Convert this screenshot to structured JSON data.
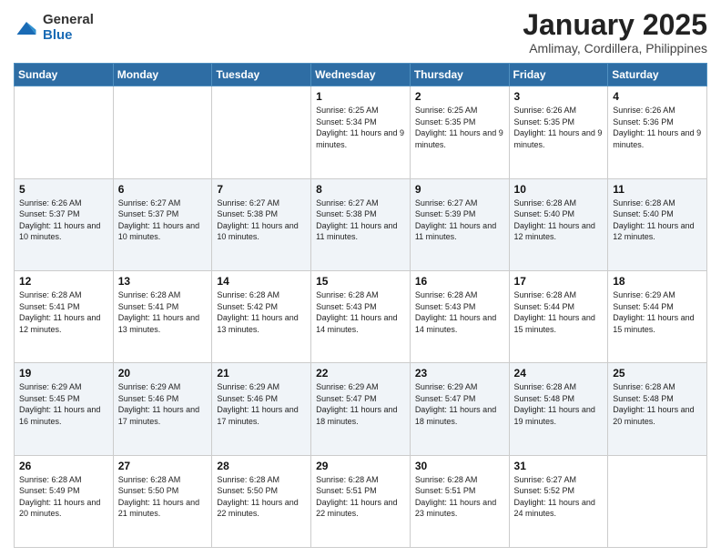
{
  "header": {
    "logo": {
      "general": "General",
      "blue": "Blue"
    },
    "title": "January 2025",
    "subtitle": "Amlimay, Cordillera, Philippines"
  },
  "weekdays": [
    "Sunday",
    "Monday",
    "Tuesday",
    "Wednesday",
    "Thursday",
    "Friday",
    "Saturday"
  ],
  "weeks": [
    [
      {
        "day": "",
        "sunrise": "",
        "sunset": "",
        "daylight": ""
      },
      {
        "day": "",
        "sunrise": "",
        "sunset": "",
        "daylight": ""
      },
      {
        "day": "",
        "sunrise": "",
        "sunset": "",
        "daylight": ""
      },
      {
        "day": "1",
        "sunrise": "Sunrise: 6:25 AM",
        "sunset": "Sunset: 5:34 PM",
        "daylight": "Daylight: 11 hours and 9 minutes."
      },
      {
        "day": "2",
        "sunrise": "Sunrise: 6:25 AM",
        "sunset": "Sunset: 5:35 PM",
        "daylight": "Daylight: 11 hours and 9 minutes."
      },
      {
        "day": "3",
        "sunrise": "Sunrise: 6:26 AM",
        "sunset": "Sunset: 5:35 PM",
        "daylight": "Daylight: 11 hours and 9 minutes."
      },
      {
        "day": "4",
        "sunrise": "Sunrise: 6:26 AM",
        "sunset": "Sunset: 5:36 PM",
        "daylight": "Daylight: 11 hours and 9 minutes."
      }
    ],
    [
      {
        "day": "5",
        "sunrise": "Sunrise: 6:26 AM",
        "sunset": "Sunset: 5:37 PM",
        "daylight": "Daylight: 11 hours and 10 minutes."
      },
      {
        "day": "6",
        "sunrise": "Sunrise: 6:27 AM",
        "sunset": "Sunset: 5:37 PM",
        "daylight": "Daylight: 11 hours and 10 minutes."
      },
      {
        "day": "7",
        "sunrise": "Sunrise: 6:27 AM",
        "sunset": "Sunset: 5:38 PM",
        "daylight": "Daylight: 11 hours and 10 minutes."
      },
      {
        "day": "8",
        "sunrise": "Sunrise: 6:27 AM",
        "sunset": "Sunset: 5:38 PM",
        "daylight": "Daylight: 11 hours and 11 minutes."
      },
      {
        "day": "9",
        "sunrise": "Sunrise: 6:27 AM",
        "sunset": "Sunset: 5:39 PM",
        "daylight": "Daylight: 11 hours and 11 minutes."
      },
      {
        "day": "10",
        "sunrise": "Sunrise: 6:28 AM",
        "sunset": "Sunset: 5:40 PM",
        "daylight": "Daylight: 11 hours and 12 minutes."
      },
      {
        "day": "11",
        "sunrise": "Sunrise: 6:28 AM",
        "sunset": "Sunset: 5:40 PM",
        "daylight": "Daylight: 11 hours and 12 minutes."
      }
    ],
    [
      {
        "day": "12",
        "sunrise": "Sunrise: 6:28 AM",
        "sunset": "Sunset: 5:41 PM",
        "daylight": "Daylight: 11 hours and 12 minutes."
      },
      {
        "day": "13",
        "sunrise": "Sunrise: 6:28 AM",
        "sunset": "Sunset: 5:41 PM",
        "daylight": "Daylight: 11 hours and 13 minutes."
      },
      {
        "day": "14",
        "sunrise": "Sunrise: 6:28 AM",
        "sunset": "Sunset: 5:42 PM",
        "daylight": "Daylight: 11 hours and 13 minutes."
      },
      {
        "day": "15",
        "sunrise": "Sunrise: 6:28 AM",
        "sunset": "Sunset: 5:43 PM",
        "daylight": "Daylight: 11 hours and 14 minutes."
      },
      {
        "day": "16",
        "sunrise": "Sunrise: 6:28 AM",
        "sunset": "Sunset: 5:43 PM",
        "daylight": "Daylight: 11 hours and 14 minutes."
      },
      {
        "day": "17",
        "sunrise": "Sunrise: 6:28 AM",
        "sunset": "Sunset: 5:44 PM",
        "daylight": "Daylight: 11 hours and 15 minutes."
      },
      {
        "day": "18",
        "sunrise": "Sunrise: 6:29 AM",
        "sunset": "Sunset: 5:44 PM",
        "daylight": "Daylight: 11 hours and 15 minutes."
      }
    ],
    [
      {
        "day": "19",
        "sunrise": "Sunrise: 6:29 AM",
        "sunset": "Sunset: 5:45 PM",
        "daylight": "Daylight: 11 hours and 16 minutes."
      },
      {
        "day": "20",
        "sunrise": "Sunrise: 6:29 AM",
        "sunset": "Sunset: 5:46 PM",
        "daylight": "Daylight: 11 hours and 17 minutes."
      },
      {
        "day": "21",
        "sunrise": "Sunrise: 6:29 AM",
        "sunset": "Sunset: 5:46 PM",
        "daylight": "Daylight: 11 hours and 17 minutes."
      },
      {
        "day": "22",
        "sunrise": "Sunrise: 6:29 AM",
        "sunset": "Sunset: 5:47 PM",
        "daylight": "Daylight: 11 hours and 18 minutes."
      },
      {
        "day": "23",
        "sunrise": "Sunrise: 6:29 AM",
        "sunset": "Sunset: 5:47 PM",
        "daylight": "Daylight: 11 hours and 18 minutes."
      },
      {
        "day": "24",
        "sunrise": "Sunrise: 6:28 AM",
        "sunset": "Sunset: 5:48 PM",
        "daylight": "Daylight: 11 hours and 19 minutes."
      },
      {
        "day": "25",
        "sunrise": "Sunrise: 6:28 AM",
        "sunset": "Sunset: 5:48 PM",
        "daylight": "Daylight: 11 hours and 20 minutes."
      }
    ],
    [
      {
        "day": "26",
        "sunrise": "Sunrise: 6:28 AM",
        "sunset": "Sunset: 5:49 PM",
        "daylight": "Daylight: 11 hours and 20 minutes."
      },
      {
        "day": "27",
        "sunrise": "Sunrise: 6:28 AM",
        "sunset": "Sunset: 5:50 PM",
        "daylight": "Daylight: 11 hours and 21 minutes."
      },
      {
        "day": "28",
        "sunrise": "Sunrise: 6:28 AM",
        "sunset": "Sunset: 5:50 PM",
        "daylight": "Daylight: 11 hours and 22 minutes."
      },
      {
        "day": "29",
        "sunrise": "Sunrise: 6:28 AM",
        "sunset": "Sunset: 5:51 PM",
        "daylight": "Daylight: 11 hours and 22 minutes."
      },
      {
        "day": "30",
        "sunrise": "Sunrise: 6:28 AM",
        "sunset": "Sunset: 5:51 PM",
        "daylight": "Daylight: 11 hours and 23 minutes."
      },
      {
        "day": "31",
        "sunrise": "Sunrise: 6:27 AM",
        "sunset": "Sunset: 5:52 PM",
        "daylight": "Daylight: 11 hours and 24 minutes."
      },
      {
        "day": "",
        "sunrise": "",
        "sunset": "",
        "daylight": ""
      }
    ]
  ]
}
